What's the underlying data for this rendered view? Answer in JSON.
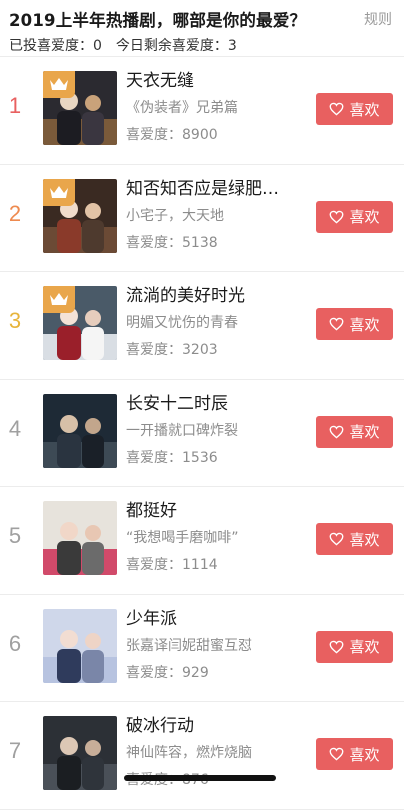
{
  "header": {
    "title": "2019上半年热播剧，哪部是你的最爱？",
    "rules_label": "规则",
    "voted_label": "已投喜爱度：",
    "voted_value": "0",
    "remaining_label": "今日剩余喜爱度：",
    "remaining_value": "3"
  },
  "like_label": "喜欢",
  "score_prefix": "喜爱度：",
  "colors": {
    "accent": "#e86060",
    "rank1": "#e86060",
    "rank2": "#ee8a4f",
    "rank3": "#e7b43b",
    "rank_other": "#a0a0a0",
    "crown": "#e9a64b"
  },
  "items": [
    {
      "rank": "1",
      "title": "天衣无缝",
      "subtitle": "《伪装者》兄弟篇",
      "score": "8900",
      "crown": true,
      "poster_icon": "poster-tian-yi-wu-feng"
    },
    {
      "rank": "2",
      "title": "知否知否应是绿肥…",
      "subtitle": "小宅子，大天地",
      "score": "5138",
      "crown": true,
      "poster_icon": "poster-zhi-fou"
    },
    {
      "rank": "3",
      "title": "流淌的美好时光",
      "subtitle": "明媚又忧伤的青春",
      "score": "3203",
      "crown": true,
      "poster_icon": "poster-liu-tang"
    },
    {
      "rank": "4",
      "title": "长安十二时辰",
      "subtitle": "一开播就口碑炸裂",
      "score": "1536",
      "crown": false,
      "poster_icon": "poster-chang-an"
    },
    {
      "rank": "5",
      "title": "都挺好",
      "subtitle": "“我想喝手磨咖啡”",
      "score": "1114",
      "crown": false,
      "poster_icon": "poster-dou-ting-hao"
    },
    {
      "rank": "6",
      "title": "少年派",
      "subtitle": "张嘉译闫妮甜蜜互怼",
      "score": "929",
      "crown": false,
      "poster_icon": "poster-shao-nian-pai"
    },
    {
      "rank": "7",
      "title": "破冰行动",
      "subtitle": "神仙阵容，燃炸烧脑",
      "score": "876",
      "crown": false,
      "poster_icon": "poster-po-bing"
    }
  ]
}
